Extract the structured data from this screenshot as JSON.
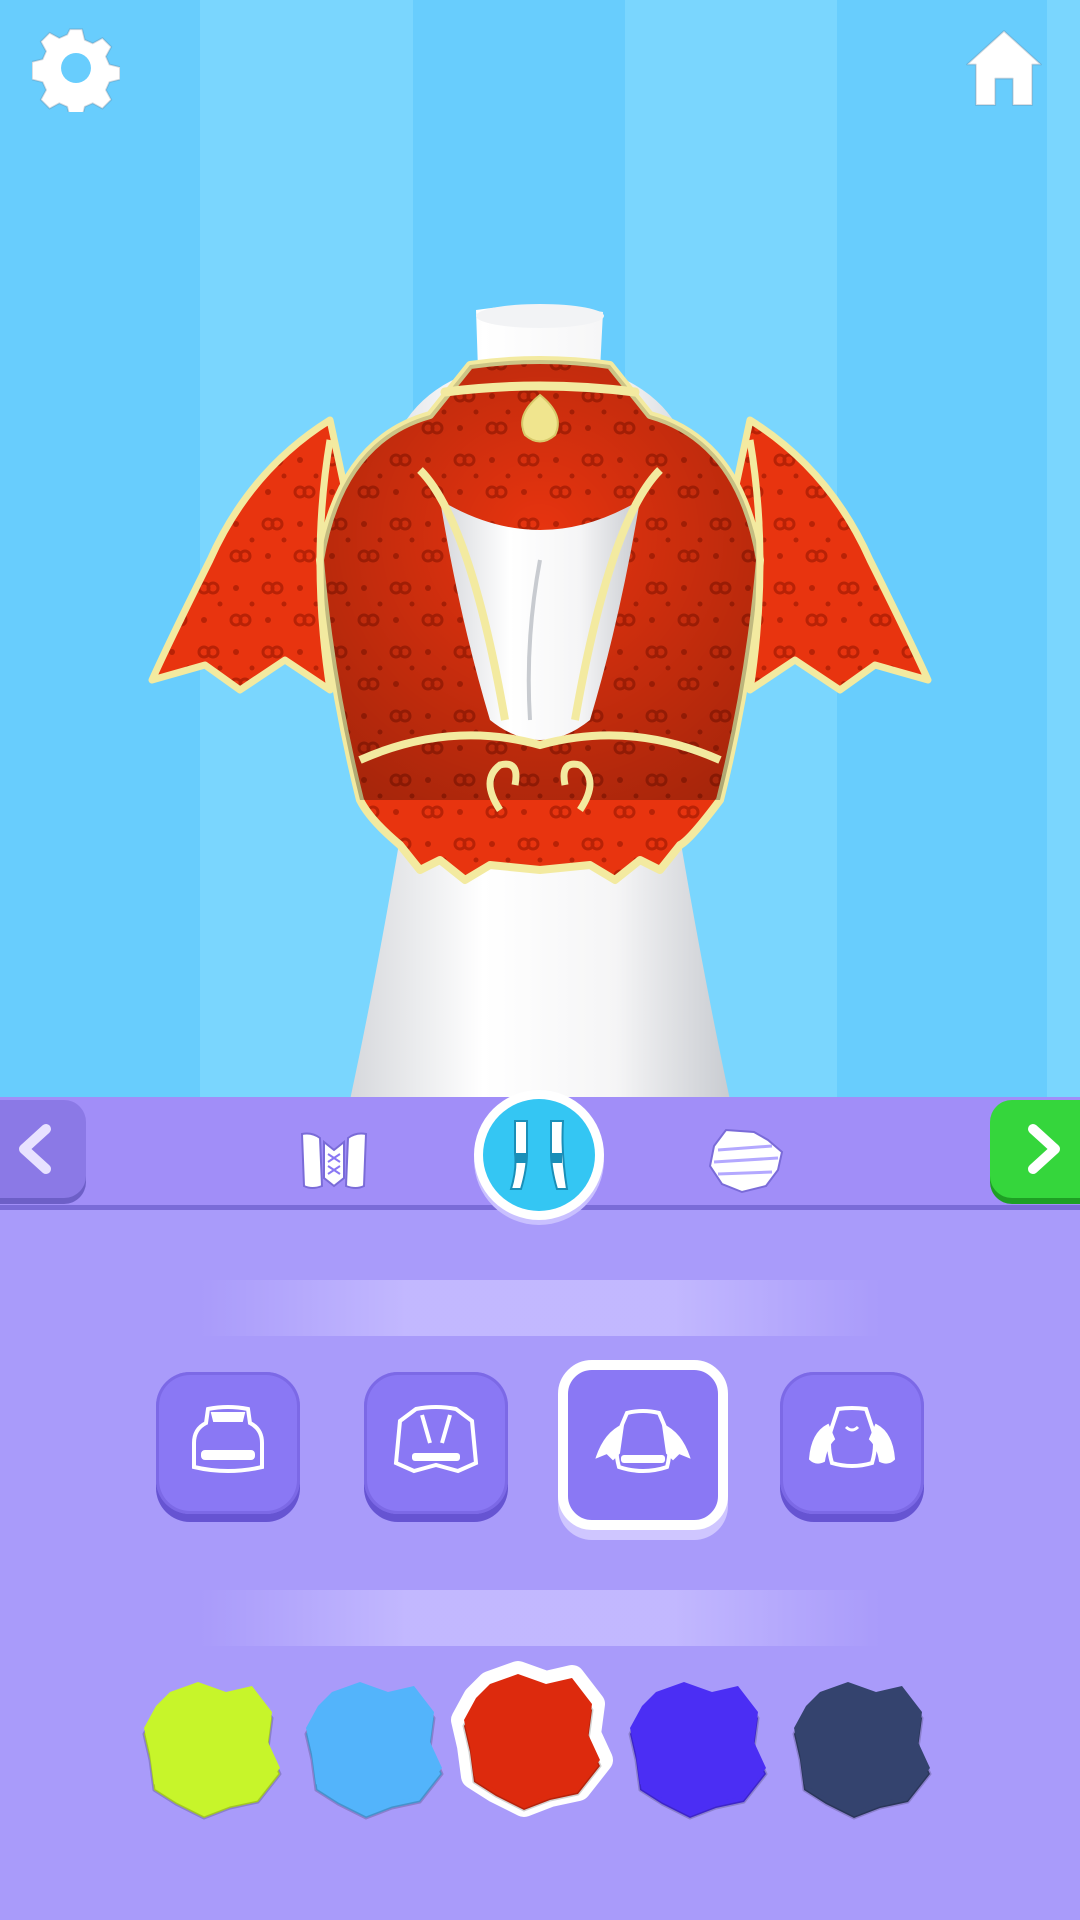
{
  "colors": {
    "background_stripe_a": "#68cdfd",
    "background_stripe_b": "#7ad6fe",
    "panel": "#a99bfa",
    "toolbar": "#a18ef8",
    "next_button": "#35d63c",
    "selected_category": "#34c6f3",
    "garment": "#e8300c",
    "trim": "#f3eaa0"
  },
  "header": {
    "left_icon": "gear-icon",
    "right_icon": "home-icon"
  },
  "toolbar": {
    "prev_icon": "chevron-left-icon",
    "next_icon": "chevron-right-icon",
    "categories": [
      {
        "icon": "corset-icon",
        "selected": false
      },
      {
        "icon": "straps-icon",
        "selected": true
      },
      {
        "icon": "fabric-pattern-icon",
        "selected": false
      }
    ]
  },
  "styles": {
    "items": [
      {
        "icon": "top-style-collar-icon",
        "selected": false
      },
      {
        "icon": "top-style-jacket-icon",
        "selected": false
      },
      {
        "icon": "top-style-winged-sleeves-icon",
        "selected": true
      },
      {
        "icon": "top-style-puff-sleeves-icon",
        "selected": false
      }
    ]
  },
  "swatches": {
    "items": [
      {
        "color": "#c7f52a",
        "selected": false
      },
      {
        "color": "#53b4fb",
        "selected": false
      },
      {
        "color": "#dd2a0d",
        "selected": true
      },
      {
        "color": "#4b2ef4",
        "selected": false
      },
      {
        "color": "#34436e",
        "selected": false
      }
    ]
  }
}
